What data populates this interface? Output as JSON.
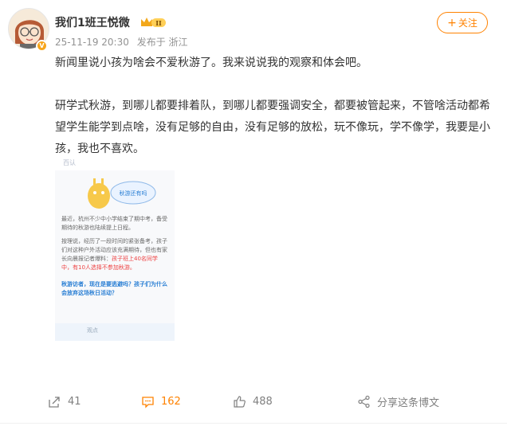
{
  "post": {
    "username": "我们1班王悦微",
    "crown_level": "II",
    "vip_badge": "V",
    "timestamp": "25-11-19 20:30",
    "source": "发布于 浙江",
    "follow_label": "关注",
    "paragraph1": "新闻里说小孩为啥会不爱秋游了。我来说说我的观察和体会吧。",
    "paragraph2": "研学式秋游，到哪儿都要排着队，到哪儿都要强调安全，都要被管起来，不管啥活动都希望学生能学到点啥，没有足够的自由，没有足够的放松，玩不像玩，学不像学，我要是小孩，我也不喜欢。"
  },
  "image": {
    "header_text": "百认",
    "bubble_text": "秋游还有吗",
    "line1": "最近，杭州不少中小学结束了期中考，备受期待的秋游也陆续提上日程。",
    "line2": "按理说，经历了一段时间的紧张备考，孩子们对这种户外活动应该充满期待，但也有家长向晨报记者爆料：",
    "line2_highlight": "孩子班上40名同学中，有10人选择不参加秋游。",
    "question": "秋游访者，现在是要逃避吗？孩子们为什么会放弃这场秋日活动？",
    "footer_text": "观点"
  },
  "actions": {
    "repost_count": "41",
    "comment_count": "162",
    "like_count": "488",
    "share_label": "分享这条博文"
  },
  "colors": {
    "accent": "#ff8200",
    "muted": "#939393"
  }
}
